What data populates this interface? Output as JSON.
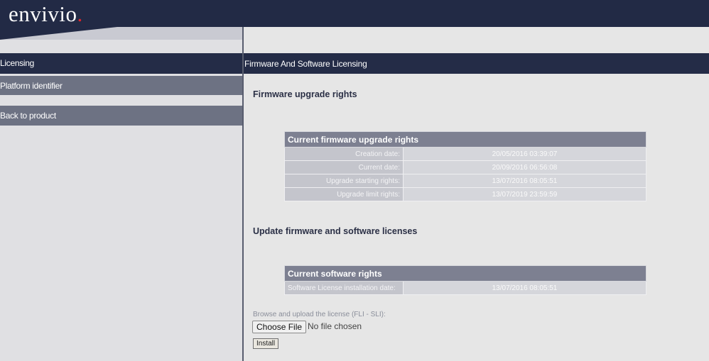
{
  "header": {
    "logo_text": "envivio",
    "logo_dot": "."
  },
  "sidebar": {
    "items": [
      {
        "label": "Licensing"
      },
      {
        "label": "Platform identifier"
      },
      {
        "label": "Back to product"
      }
    ]
  },
  "main": {
    "title": "Firmware And Software Licensing",
    "firmware_heading": "Firmware upgrade rights",
    "firmware_table": {
      "header": "Current firmware upgrade rights",
      "rows": [
        {
          "label": "Creation date:",
          "value": "20/05/2016 03:39:07"
        },
        {
          "label": "Current date:",
          "value": "20/09/2016 06:56:08"
        },
        {
          "label": "Upgrade starting rights:",
          "value": "13/07/2016 08:05:51"
        },
        {
          "label": "Upgrade limit rights:",
          "value": "13/07/2019 23:59:59"
        }
      ]
    },
    "update_heading": "Update firmware and software licenses",
    "software_table": {
      "header": "Current software rights",
      "rows": [
        {
          "label": "Software License installation date:",
          "value": "13/07/2016 08:05:51"
        }
      ]
    },
    "upload": {
      "label": "Browse and upload the license (FLI - SLI):",
      "choose_button": "Choose File",
      "no_file": "No file chosen",
      "install_button": "Install"
    }
  },
  "colors": {
    "header_bg": "#222a45",
    "accent_red": "#e0252b",
    "nav_gray": "#6d7283",
    "table_header": "#7d8091"
  }
}
